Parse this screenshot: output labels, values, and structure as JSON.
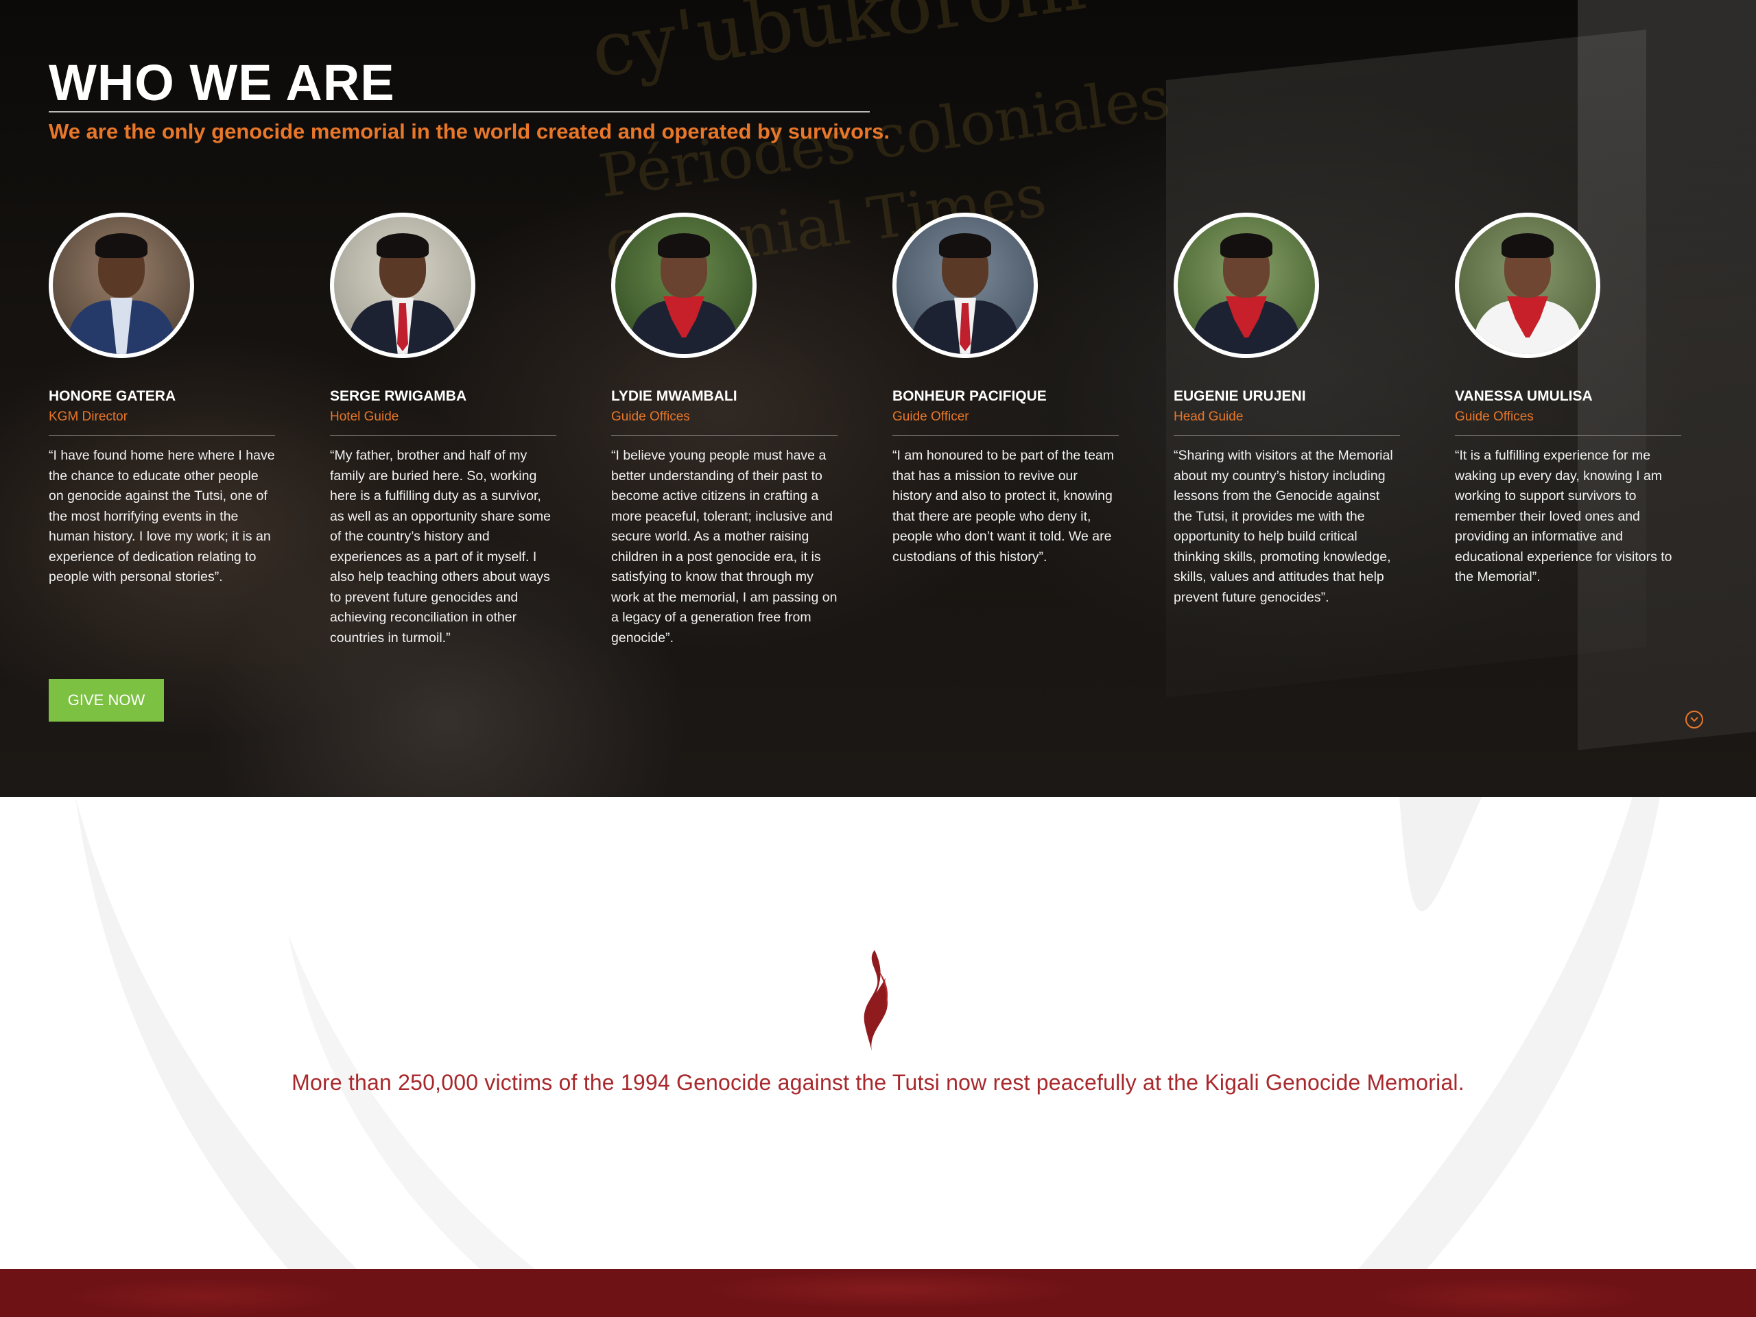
{
  "hero": {
    "title": "WHO WE ARE",
    "subtitle": "We are the only genocide memorial in the world created and operated by survivors.",
    "give_label": "GIVE NOW",
    "scroll_icon": "chevron-down-circle-icon"
  },
  "team": [
    {
      "name": "HONORE GATERA",
      "role": "KGM Director",
      "quote": "“I have found home here where I have the chance to educate other people on genocide against the Tutsi, one of the most horrifying events in the human history. I love my work; it is an experience of dedication relating to people with personal stories”."
    },
    {
      "name": "SERGE RWIGAMBA",
      "role": "Hotel Guide",
      "quote": "“My father, brother and half of my family are buried here. So, working here is a fulfilling duty as a survivor, as well as an opportunity share some of the country’s history and experiences as a part of it myself. I also help teaching others about ways to prevent future genocides and achieving reconciliation in other countries in turmoil.”"
    },
    {
      "name": "LYDIE MWAMBALI",
      "role": "Guide Offices",
      "quote": "“I believe young people must have a better understanding of their past to become active citizens in crafting a more peaceful, tolerant; inclusive and secure world. As a mother raising children in a post genocide era, it is satisfying to know that through my work at the memorial, I am passing on a legacy of a generation free from genocide”."
    },
    {
      "name": "BONHEUR PACIFIQUE",
      "role": "Guide Officer",
      "quote": "“I am honoured to be part of the team that has a mission to revive our history and also to protect it, knowing that there are people who deny it, people who don’t want it told. We are custodians of this history”."
    },
    {
      "name": "EUGENIE URUJENI",
      "role": "Head Guide",
      "quote": "“Sharing with visitors at the Memorial about my country’s history including lessons from the Genocide against the Tutsi, it provides me with the opportunity to help build critical thinking skills, promoting knowledge, skills, values and attitudes that help prevent future genocides”."
    },
    {
      "name": "VANESSA UMULISA",
      "role": "Guide Offices",
      "quote": "“It is a fulfilling experience for me waking up every day, knowing I am working to support survivors to remember their loved ones and providing an informative and educational experience for visitors to the Memorial”."
    }
  ],
  "memorial": {
    "flame_icon": "flame-icon",
    "statement": "More than 250,000 victims of the 1994 Genocide against the Tutsi now rest peacefully at the Kigali Genocide Memorial."
  },
  "colors": {
    "accent_orange": "#e8772a",
    "button_green": "#7cc142",
    "memorial_red": "#a8282c",
    "footer_red": "#6e1216"
  }
}
